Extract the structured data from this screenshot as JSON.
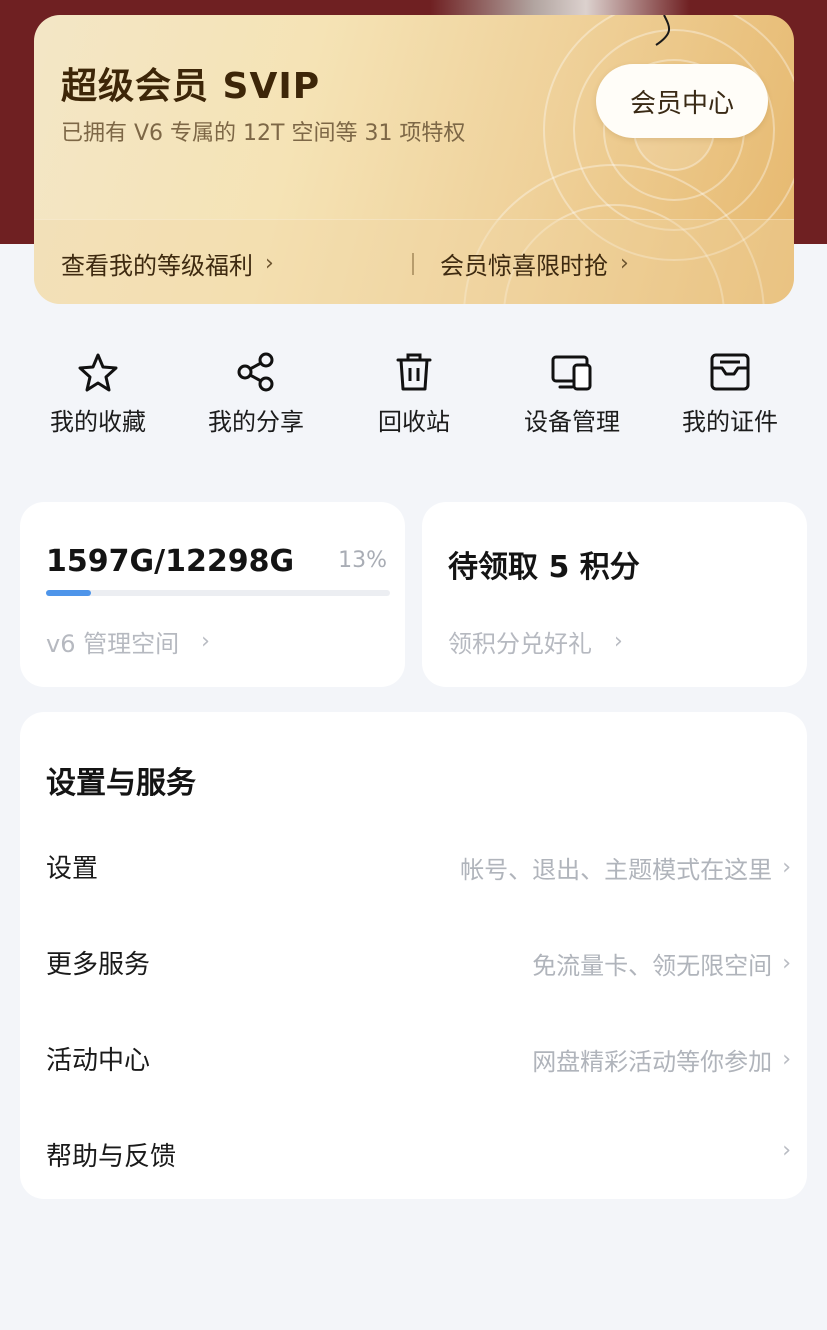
{
  "vip": {
    "title": "超级会员 SVIP",
    "subtitle": "已拥有 V6 专属的 12T 空间等 31 项特权",
    "center_button": "会员中心",
    "links": [
      {
        "label": "查看我的等级福利",
        "chevron": "›"
      },
      {
        "label": "会员惊喜限时抢",
        "chevron": "›"
      }
    ]
  },
  "quick": [
    {
      "label": "我的收藏",
      "icon": "star-icon"
    },
    {
      "label": "我的分享",
      "icon": "share-icon"
    },
    {
      "label": "回收站",
      "icon": "trash-icon"
    },
    {
      "label": "设备管理",
      "icon": "devices-icon"
    },
    {
      "label": "我的证件",
      "icon": "id-card-icon"
    }
  ],
  "storage": {
    "value": "1597G/12298G",
    "percent": "13%",
    "fraction": 0.13,
    "link": "v6 管理空间",
    "chevron": "›"
  },
  "points": {
    "title": "待领取 5 积分",
    "link": "领积分兑好礼",
    "chevron": "›"
  },
  "settings": {
    "title": "设置与服务",
    "rows": [
      {
        "label": "设置",
        "hint": "帐号、退出、主题模式在这里",
        "chevron": "›"
      },
      {
        "label": "更多服务",
        "hint": "免流量卡、领无限空间",
        "chevron": "›"
      },
      {
        "label": "活动中心",
        "hint": "网盘精彩活动等你参加",
        "chevron": "›"
      },
      {
        "label": "帮助与反馈",
        "hint": "",
        "chevron": "›"
      }
    ]
  },
  "colors": {
    "header_bg": "#6f2022",
    "progress": "#4e95ea",
    "page_bg": "#f3f5f9"
  }
}
